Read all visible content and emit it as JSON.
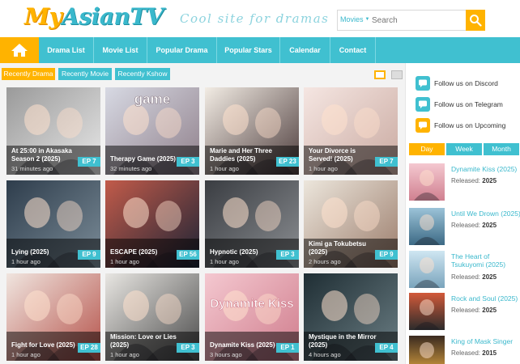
{
  "site": {
    "logo_part1": "My",
    "logo_part2": "AsianTV",
    "tagline": "Cool site for dramas"
  },
  "search": {
    "category": "Movies",
    "placeholder": "Search"
  },
  "nav": [
    "Drama List",
    "Movie List",
    "Popular Drama",
    "Popular Stars",
    "Calendar",
    "Contact"
  ],
  "tabs": [
    "Recently Drama",
    "Recently Movie",
    "Recently Kshow"
  ],
  "cards": [
    {
      "title": "At 25:00 in Akasaka Season 2 (2025)",
      "time": "31 minutes ago",
      "ep": "EP 7",
      "c1": "#9a9a9a",
      "c2": "#e8e8e8"
    },
    {
      "title": "Therapy Game (2025)",
      "time": "32 minutes ago",
      "ep": "EP 3",
      "c1": "#d7d9e3",
      "c2": "#8f7f8a",
      "art": "game"
    },
    {
      "title": "Marie and Her Three Daddies (2025)",
      "time": "1 hour ago",
      "ep": "EP 23",
      "c1": "#f2ece4",
      "c2": "#4d3c3c"
    },
    {
      "title": "Your Divorce is Served! (2025)",
      "time": "1 hour ago",
      "ep": "EP 7",
      "c1": "#f5e6e2",
      "c2": "#c9a9a0"
    },
    {
      "title": "Lying (2025)",
      "time": "1 hour ago",
      "ep": "EP 9",
      "c1": "#2e3d4c",
      "c2": "#7c8d99"
    },
    {
      "title": "ESCAPE (2025)",
      "time": "1 hour ago",
      "ep": "EP 56",
      "c1": "#c25b4a",
      "c2": "#1b2335"
    },
    {
      "title": "Hypnotic (2025)",
      "time": "1 hour ago",
      "ep": "EP 3",
      "c1": "#3a3d42",
      "c2": "#8c8f93"
    },
    {
      "title": "Kimi ga Tokubetsu (2025)",
      "time": "2 hours ago",
      "ep": "EP 9",
      "c1": "#ece6dc",
      "c2": "#9a7b6a"
    },
    {
      "title": "Fight for Love (2025)",
      "time": "1 hour ago",
      "ep": "EP 28",
      "c1": "#f0e5df",
      "c2": "#b5524a"
    },
    {
      "title": "Mission: Love or Lies (2025)",
      "time": "1 hour ago",
      "ep": "EP 3",
      "c1": "#e8e6e2",
      "c2": "#4a4a4a"
    },
    {
      "title": "Dynamite Kiss (2025)",
      "time": "3 hours ago",
      "ep": "EP 1",
      "c1": "#f4c8d0",
      "c2": "#cf7c8c",
      "art": "Dynamite Kiss"
    },
    {
      "title": "Mystique in the Mirror (2025)",
      "time": "4 hours ago",
      "ep": "EP 4",
      "c1": "#1f2e34",
      "c2": "#6c7f85"
    }
  ],
  "follow": [
    {
      "label": "Follow us on Discord",
      "color": "#40c0d0"
    },
    {
      "label": "Follow us on Telegram",
      "color": "#40c0d0"
    },
    {
      "label": "Follow us on Upcoming",
      "color": "#ffb300"
    }
  ],
  "side_tabs": [
    "Day",
    "Week",
    "Month"
  ],
  "released_label": "Released:",
  "ranking": [
    {
      "title": "Dynamite Kiss (2025)",
      "year": "2025",
      "c1": "#f4c8d0",
      "c2": "#d08090"
    },
    {
      "title": "Until We Drown (2025)",
      "year": "2025",
      "c1": "#9bc3d8",
      "c2": "#3d6a85"
    },
    {
      "title": "The Heart of Tsukuyomi (2025)",
      "year": "2025",
      "c1": "#cfe6f2",
      "c2": "#7aa4bc"
    },
    {
      "title": "Rock and Soul (2025)",
      "year": "2025",
      "c1": "#d25a3a",
      "c2": "#2b2b2b"
    },
    {
      "title": "King of Mask Singer",
      "year": "2015",
      "c1": "#3a2a20",
      "c2": "#d8a040"
    }
  ]
}
